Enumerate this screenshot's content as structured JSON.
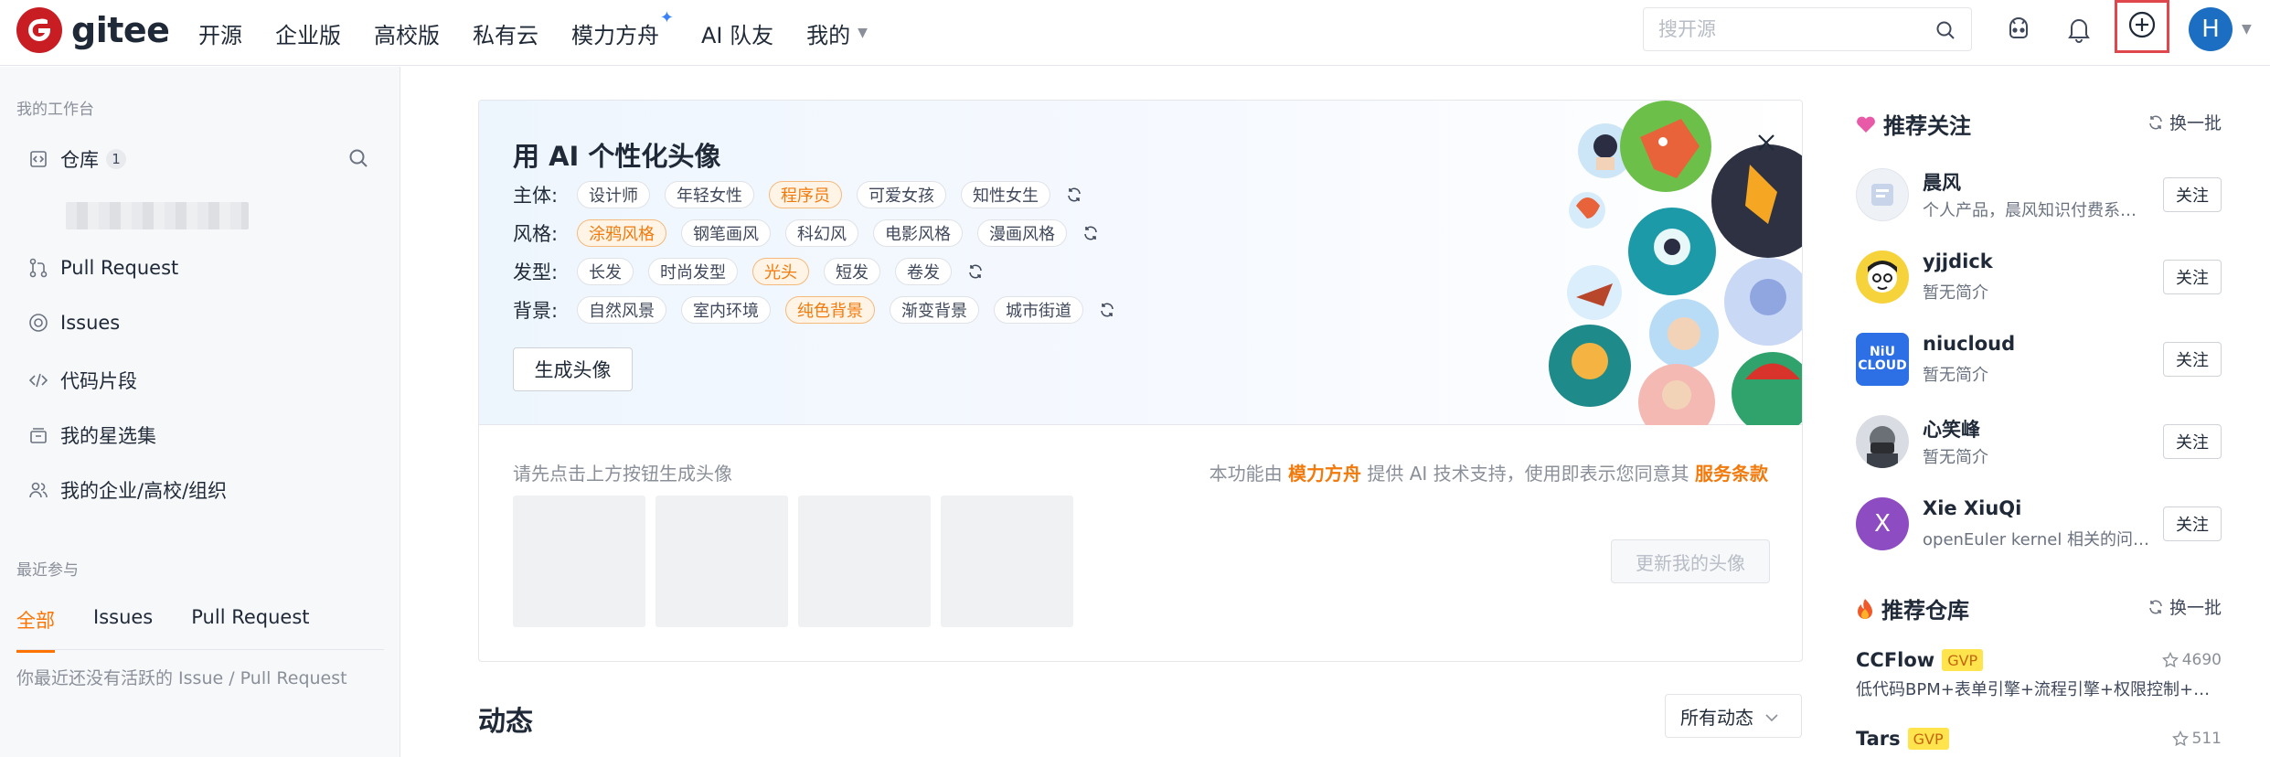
{
  "brand": {
    "name": "gitee",
    "color": "#c71d23"
  },
  "topnav": {
    "items": [
      "开源",
      "企业版",
      "高校版",
      "私有云",
      "模力方舟",
      "AI 队友",
      "我的"
    ]
  },
  "search": {
    "placeholder": "搜开源",
    "value": ""
  },
  "user": {
    "avatar_letter": "H",
    "avatar_color": "#1b6ec2"
  },
  "sidebar": {
    "workspace_title": "我的工作台",
    "repo_label": "仓库",
    "repo_count": "1",
    "items": [
      "Pull Request",
      "Issues",
      "代码片段",
      "我的星选集",
      "我的企业/高校/组织"
    ],
    "recent_title": "最近参与",
    "tabs": [
      "全部",
      "Issues",
      "Pull Request"
    ],
    "active_tab": "全部",
    "empty_text": "你最近还没有活跃的 Issue / Pull Request"
  },
  "ai_card": {
    "title": "用 AI 个性化头像",
    "rows": [
      {
        "label": "主体:",
        "options": [
          "设计师",
          "年轻女性",
          "程序员",
          "可爱女孩",
          "知性女生"
        ],
        "selected": "程序员"
      },
      {
        "label": "风格:",
        "options": [
          "涂鸦风格",
          "钢笔画风",
          "科幻风",
          "电影风格",
          "漫画风格"
        ],
        "selected": "涂鸦风格"
      },
      {
        "label": "发型:",
        "options": [
          "长发",
          "时尚发型",
          "光头",
          "短发",
          "卷发"
        ],
        "selected": "光头"
      },
      {
        "label": "背景:",
        "options": [
          "自然风景",
          "室内环境",
          "纯色背景",
          "渐变背景",
          "城市街道"
        ],
        "selected": "纯色背景"
      }
    ],
    "generate_label": "生成头像",
    "hint": "请先点击上方按钮生成头像",
    "terms_prefix": "本功能由",
    "terms_provider": "模力方舟",
    "terms_middle": "提供 AI 技术支持，使用即表示您同意其",
    "terms_link": "服务条款",
    "update_label": "更新我的头像",
    "accent": "#f27a0c"
  },
  "feed": {
    "title": "动态",
    "filter": "所有动态"
  },
  "recommend_users": {
    "title": "推荐关注",
    "swap_label": "换一批",
    "follow_label": "关注",
    "users": [
      {
        "name": "晨风",
        "desc": "个人产品，晨风知识付费系统..."
      },
      {
        "name": "yjjdick",
        "desc": "暂无简介"
      },
      {
        "name": "niucloud",
        "desc": "暂无简介",
        "avatar_text": "NiU CLOUD"
      },
      {
        "name": "心笑峰",
        "desc": "暂无简介"
      },
      {
        "name": "Xie XiuQi",
        "desc": "openEuler kernel 相关的问题...",
        "avatar_text": "X"
      }
    ]
  },
  "recommend_repos": {
    "title": "推荐仓库",
    "swap_label": "换一批",
    "repos": [
      {
        "name": "CCFlow",
        "badge": "GVP",
        "stars": "4690",
        "desc": "低代码BPM+表单引擎+流程引擎+权限控制+大..."
      },
      {
        "name": "Tars",
        "badge": "GVP",
        "stars": "511",
        "desc": ""
      }
    ]
  }
}
